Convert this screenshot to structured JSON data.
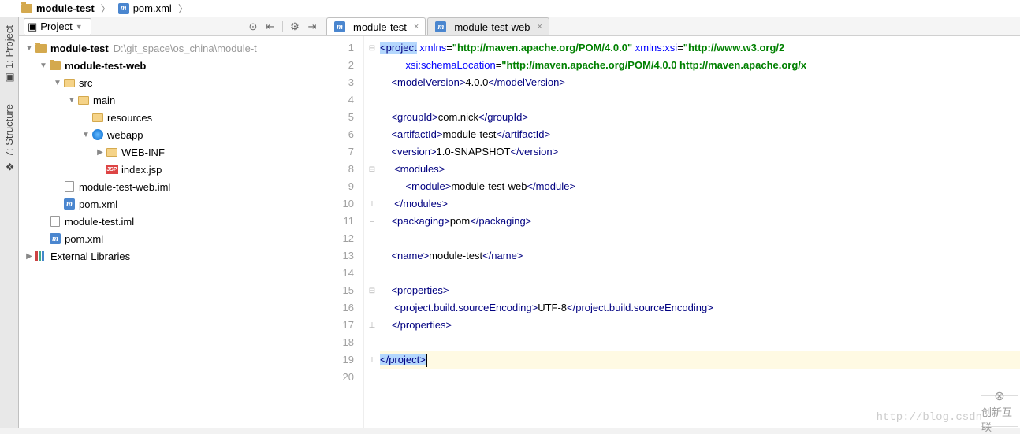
{
  "breadcrumb": [
    {
      "icon": "folder",
      "label": "module-test",
      "bold": true
    },
    {
      "icon": "m",
      "label": "pom.xml",
      "bold": false
    }
  ],
  "sidebar_tabs": [
    {
      "label": "1: Project"
    },
    {
      "label": "7: Structure"
    }
  ],
  "project_toolbar": {
    "label": "Project"
  },
  "tree": [
    {
      "indent": 0,
      "arrow": "▼",
      "icon": "folder",
      "label": "module-test",
      "bold": true,
      "path": "D:\\git_space\\os_china\\module-t"
    },
    {
      "indent": 1,
      "arrow": "▼",
      "icon": "folder",
      "label": "module-test-web",
      "bold": true
    },
    {
      "indent": 2,
      "arrow": "▼",
      "icon": "folder-open",
      "label": "src"
    },
    {
      "indent": 3,
      "arrow": "▼",
      "icon": "folder-open",
      "label": "main"
    },
    {
      "indent": 4,
      "arrow": "",
      "icon": "folder-open",
      "label": "resources"
    },
    {
      "indent": 4,
      "arrow": "▼",
      "icon": "web",
      "label": "webapp"
    },
    {
      "indent": 5,
      "arrow": "▶",
      "icon": "folder-open",
      "label": "WEB-INF"
    },
    {
      "indent": 5,
      "arrow": "",
      "icon": "jsp",
      "label": "index.jsp"
    },
    {
      "indent": 2,
      "arrow": "",
      "icon": "file",
      "label": "module-test-web.iml"
    },
    {
      "indent": 2,
      "arrow": "",
      "icon": "m",
      "label": "pom.xml"
    },
    {
      "indent": 1,
      "arrow": "",
      "icon": "file",
      "label": "module-test.iml"
    },
    {
      "indent": 1,
      "arrow": "",
      "icon": "m",
      "label": "pom.xml"
    },
    {
      "indent": 0,
      "arrow": "▶",
      "icon": "lib",
      "label": "External Libraries"
    }
  ],
  "editor_tabs": [
    {
      "label": "module-test",
      "active": true
    },
    {
      "label": "module-test-web",
      "active": false
    }
  ],
  "code_lines": 20,
  "code": {
    "l1": {
      "pre": "",
      "html": "<span class='sel'><span class='tag'>&lt;project</span></span> <span class='attr'>xmlns</span>=<span class='str'>\"http://maven.apache.org/POM/4.0.0\"</span> <span class='attr'>xmlns:xsi</span>=<span class='str'>\"http://www.w3.org/2</span>"
    },
    "l2": {
      "pre": "         ",
      "html": "<span class='attr'>xsi:schemaLocation</span>=<span class='str'>\"http://maven.apache.org/POM/4.0.0 http://maven.apache.org/x</span>"
    },
    "l3": {
      "pre": "    ",
      "html": "<span class='tag'>&lt;modelVersion&gt;</span>4.0.0<span class='tag'>&lt;/modelVersion&gt;</span>"
    },
    "l4": {
      "pre": "",
      "html": ""
    },
    "l5": {
      "pre": "    ",
      "html": "<span class='tag'>&lt;groupId&gt;</span>com.nick<span class='tag'>&lt;/groupId&gt;</span>"
    },
    "l6": {
      "pre": "    ",
      "html": "<span class='tag'>&lt;artifactId&gt;</span>module-test<span class='tag'>&lt;/artifactId&gt;</span>"
    },
    "l7": {
      "pre": "    ",
      "html": "<span class='tag'>&lt;version&gt;</span>1.0-SNAPSHOT<span class='tag'>&lt;/version&gt;</span>"
    },
    "l8": {
      "pre": "     ",
      "html": "<span class='tag'>&lt;modules&gt;</span>"
    },
    "l9": {
      "pre": "         ",
      "html": "<span class='tag'>&lt;module&gt;</span>module-test-web<span class='tag'>&lt;/<span class='link'>module</span>&gt;</span>"
    },
    "l10": {
      "pre": "     ",
      "html": "<span class='tag'>&lt;/modules&gt;</span>"
    },
    "l11": {
      "pre": "    ",
      "html": "<span class='tag'>&lt;packaging&gt;</span>pom<span class='tag'>&lt;/packaging&gt;</span>"
    },
    "l12": {
      "pre": "",
      "html": ""
    },
    "l13": {
      "pre": "    ",
      "html": "<span class='tag'>&lt;name&gt;</span>module-test<span class='tag'>&lt;/name&gt;</span>"
    },
    "l14": {
      "pre": "",
      "html": ""
    },
    "l15": {
      "pre": "    ",
      "html": "<span class='tag'>&lt;properties&gt;</span>"
    },
    "l16": {
      "pre": "     ",
      "html": "<span class='tag'>&lt;project.build.sourceEncoding&gt;</span>UTF-8<span class='tag'>&lt;/project.build.sourceEncoding&gt;</span>"
    },
    "l17": {
      "pre": "    ",
      "html": "<span class='tag'>&lt;/properties&gt;</span>"
    },
    "l18": {
      "pre": "",
      "html": ""
    },
    "l19": {
      "pre": "",
      "html": "<span class='sel'><span class='tag'>&lt;/project&gt;</span></span><span class='caret'></span>"
    },
    "l20": {
      "pre": "",
      "html": ""
    }
  },
  "watermark": "http://blog.csdn.net/",
  "logo": "创新互联"
}
